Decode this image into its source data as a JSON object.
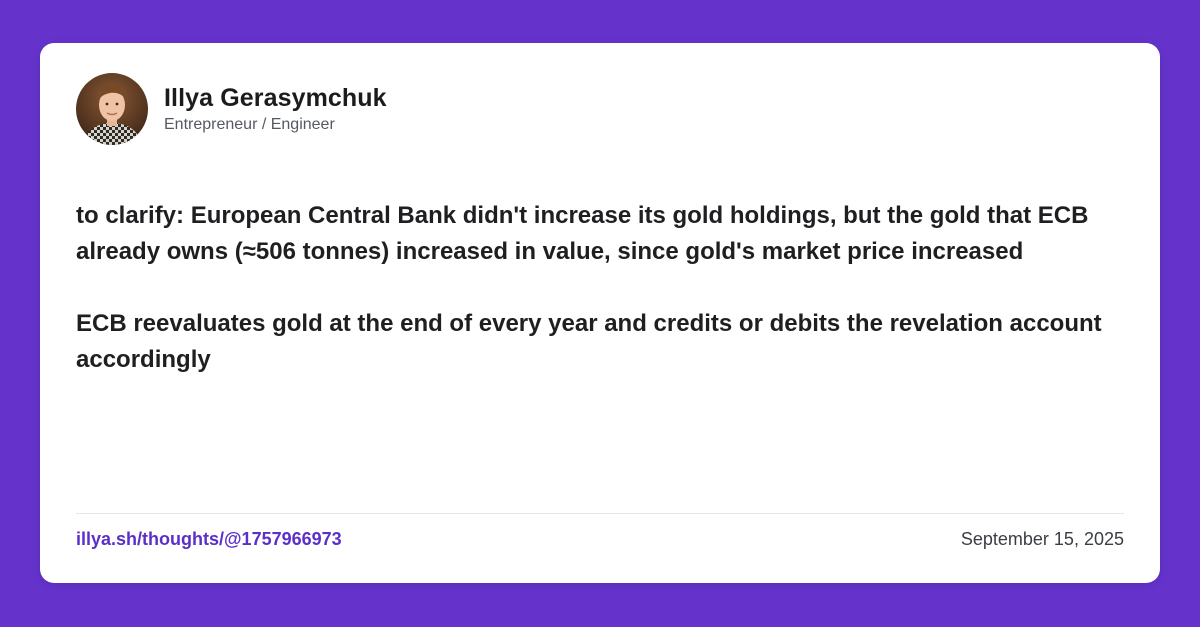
{
  "colors": {
    "background": "#6533cc",
    "card": "#ffffff",
    "link": "#5b2fc9"
  },
  "author": {
    "name": "Illya Gerasymchuk",
    "title": "Entrepreneur / Engineer",
    "avatar_icon": "profile-photo"
  },
  "post": {
    "paragraphs": [
      "to clarify: European Central Bank didn't increase its gold holdings, but the gold that ECB already owns (≈506 tonnes) increased in value, since gold's market price increased",
      "ECB reevaluates gold at the end of every year and credits or debits the revelation account accordingly"
    ]
  },
  "footer": {
    "link_text": "illya.sh/thoughts/@1757966973",
    "date": "September 15, 2025"
  }
}
